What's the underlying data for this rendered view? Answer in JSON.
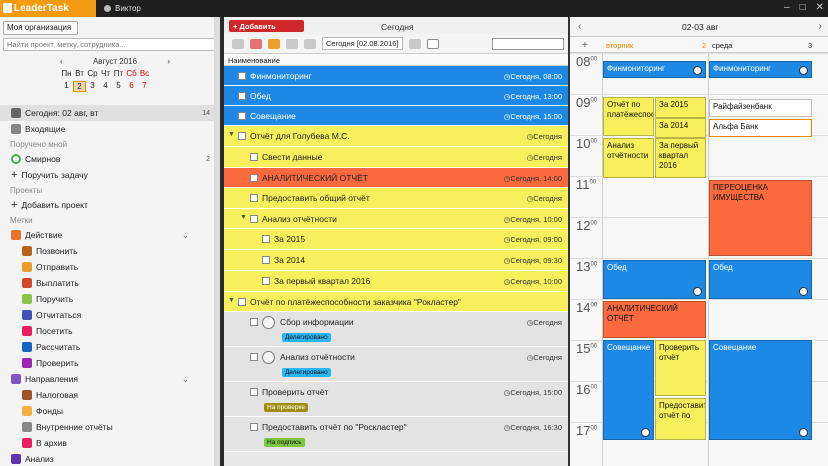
{
  "app": {
    "logo": "LeaderTask",
    "user": "Виктор"
  },
  "colors": {
    "accent": "#f39c12",
    "blue": "#1e88e5",
    "yellow": "#f7ef5b",
    "orange": "#fa6a3e",
    "red_button": "#d0282a"
  },
  "left": {
    "org_button": "Моя организация",
    "search_placeholder": "Найти проект, метку, сотрудника...",
    "calendar": {
      "month": "Август 2016",
      "weekdays": [
        "Пн",
        "Вт",
        "Ср",
        "Чт",
        "Пт",
        "Сб",
        "Вс"
      ],
      "days": [
        "1",
        "2",
        "3",
        "4",
        "5",
        "6",
        "7"
      ],
      "selected": "2"
    },
    "today": {
      "label": "Сегодня: 02 авг, вт",
      "count": "14"
    },
    "inbox": "Входящие",
    "assigned_section": "Поручено мной",
    "person": {
      "name": "Смирнов",
      "count": "2"
    },
    "assign_task": "Поручить задачу",
    "projects_section": "Проекты",
    "add_project": "Добавить проект",
    "tags_section": "Метки",
    "action_group": "Действие",
    "actions": [
      "Позвонить",
      "Отправить",
      "Выплатить",
      "Поручить",
      "Отчитаться",
      "Посетить",
      "Рассчитать",
      "Проверить"
    ],
    "direction_group": "Направления",
    "directions": [
      "Налоговая",
      "Фонды",
      "Внутренние отчёты",
      "В архив"
    ],
    "analysis": "Анализ"
  },
  "mid": {
    "add_task": "Добавить задачу",
    "title": "Сегодня",
    "date_filter": "Сегодня [02.08.2016]",
    "column": "Наименование",
    "tasks": [
      {
        "name": "Финмониторинг",
        "date": "Сегодня, 08:00"
      },
      {
        "name": "Обед",
        "date": "Сегодня, 13:00"
      },
      {
        "name": "Совещание",
        "date": "Сегодня, 15:00"
      },
      {
        "name": "Отчёт для Голубева М.С.",
        "date": "Сегодня"
      },
      {
        "name": "Свести данные",
        "date": "Сегодня"
      },
      {
        "name": "АНАЛИТИЧЕСКИЙ ОТЧЁТ",
        "date": "Сегодня, 14:00"
      },
      {
        "name": "Предоставить общий отчёт",
        "date": "Сегодня"
      },
      {
        "name": "Анализ отчётности",
        "date": "Сегодня, 10:00"
      },
      {
        "name": "За 2015",
        "date": "Сегодня, 09:00"
      },
      {
        "name": "За 2014",
        "date": "Сегодня, 09:30"
      },
      {
        "name": "За первый квартал 2016",
        "date": "Сегодня, 10:00"
      },
      {
        "name": "Отчёт по платёжеспособности заказчика \"Рокластер\"",
        "date": ""
      },
      {
        "name": "Сбор информации",
        "date": "Сегодня",
        "tag": "Делегировано"
      },
      {
        "name": "Анализ отчётности",
        "date": "Сегодня",
        "tag": "Делегировано"
      },
      {
        "name": "Проверить отчёт",
        "date": "Сегодня, 15:00",
        "tag": "На проверке"
      },
      {
        "name": "Предоставить отчёт по \"Роскластер\"",
        "date": "Сегодня, 16:30",
        "tag": "На подпись"
      }
    ]
  },
  "right": {
    "range": "02-03 авг",
    "day1": "вторник",
    "day1_num": "2",
    "day2": "среда",
    "day2_num": "3",
    "hours": [
      "08",
      "09",
      "10",
      "11",
      "12",
      "13",
      "14",
      "15",
      "16",
      "17"
    ],
    "minutes": "00",
    "events": {
      "e1": "Финмониторинг",
      "e2": "Финмониторинг",
      "e3": "Отчёт по платёжеспособност",
      "e4": "За 2015",
      "e5": "За 2014",
      "e6": "Анализ отчётности",
      "e7": "За первый квартал 2016",
      "e8": "Райфайзенбанк",
      "e9": "Альфа Банк",
      "e10": "ПЕРЕОЦЕНКА ИМУЩЕСТВА",
      "e11": "Обед",
      "e12": "Обед",
      "e13": "АНАЛИТИЧЕСКИЙ ОТЧЁТ",
      "e14": "Совещание",
      "e15": "Проверить отчёт",
      "e16": "Совещание",
      "e17": "Предоставить отчёт по"
    }
  }
}
